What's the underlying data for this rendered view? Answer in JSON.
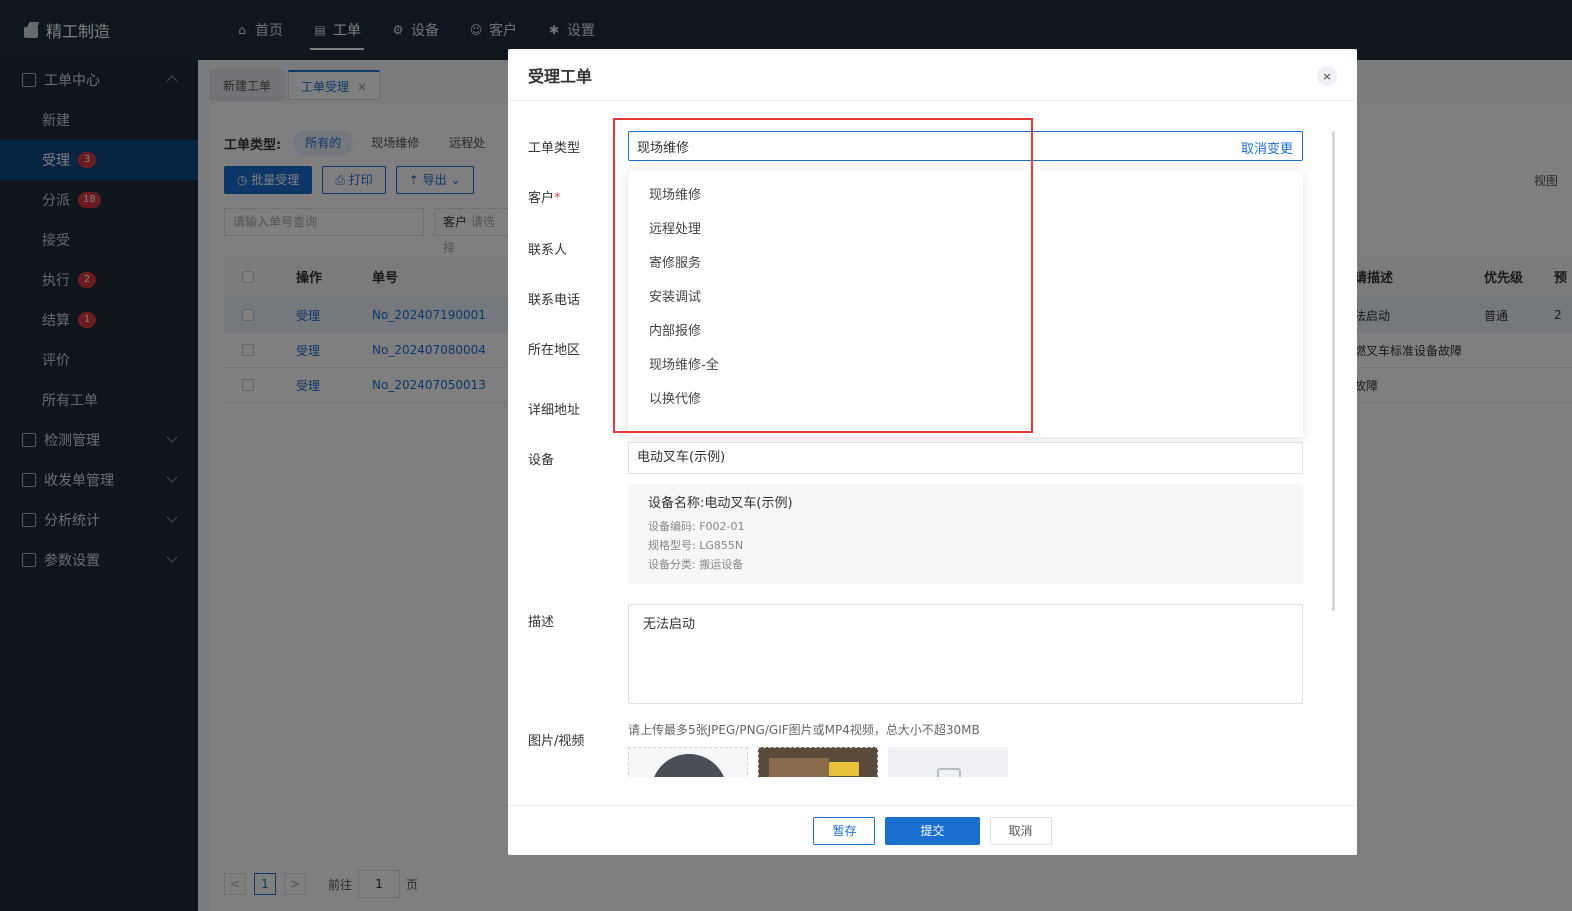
{
  "app": {
    "title": "精工制造"
  },
  "topnav": [
    {
      "label": "首页",
      "icon": "home-icon",
      "glyph": "⌂"
    },
    {
      "label": "工单",
      "icon": "workorder-icon",
      "glyph": "▤"
    },
    {
      "label": "设备",
      "icon": "device-icon",
      "glyph": "⚙"
    },
    {
      "label": "客户",
      "icon": "customer-icon",
      "glyph": "☺"
    },
    {
      "label": "设置",
      "icon": "settings-icon",
      "glyph": "✱"
    }
  ],
  "sidebar": {
    "group_workorder": "工单中心",
    "items": [
      {
        "label": "新建",
        "badge": ""
      },
      {
        "label": "受理",
        "badge": "3"
      },
      {
        "label": "分派",
        "badge": "18"
      },
      {
        "label": "接受",
        "badge": ""
      },
      {
        "label": "执行",
        "badge": "2"
      },
      {
        "label": "结算",
        "badge": "1"
      },
      {
        "label": "评价",
        "badge": ""
      },
      {
        "label": "所有工单",
        "badge": ""
      }
    ],
    "groups": [
      "检测管理",
      "收发单管理",
      "分析统计",
      "参数设置"
    ]
  },
  "tabs": [
    {
      "label": "新建工单"
    },
    {
      "label": "工单受理",
      "close": "×"
    }
  ],
  "list": {
    "filter_label": "工单类型:",
    "chips": [
      "所有的",
      "现场维修",
      "远程处"
    ],
    "buttons": [
      "批量受理",
      "打印",
      "导出"
    ],
    "search_placeholder": "请输入单号查询",
    "customer_label": "客户",
    "customer_placeholder": "请选择",
    "view_label": "视图",
    "columns": [
      "操作",
      "单号",
      "请描述",
      "优先级",
      "预"
    ],
    "rows": [
      {
        "action": "受理",
        "no": "No_202407190001",
        "desc": "法启动",
        "priority": "普通",
        "extra": "2"
      },
      {
        "action": "受理",
        "no": "No_202407080004",
        "desc": "燃叉车标准设备故障",
        "priority": "",
        "extra": ""
      },
      {
        "action": "受理",
        "no": "No_202407050013",
        "desc": "故障",
        "priority": "",
        "extra": ""
      }
    ],
    "pager": {
      "prev": "<",
      "current": "1",
      "next": ">",
      "goto_label": "前往",
      "goto_value": "1",
      "page_label": "页"
    }
  },
  "modal": {
    "title": "受理工单",
    "close": "×",
    "labels": {
      "type": "工单类型",
      "customer": "客户",
      "required_mark": "*",
      "contact": "联系人",
      "phone": "联系电话",
      "region": "所在地区",
      "address": "详细地址",
      "device": "设备",
      "desc": "描述",
      "media": "图片/视频"
    },
    "type_value": "现场维修",
    "cancel_change": "取消变更",
    "dropdown_options": [
      "现场维修",
      "远程处理",
      "寄修服务",
      "安装调试",
      "内部报修",
      "现场维修-全",
      "以换代修"
    ],
    "device_value": "电动叉车(示例)",
    "device_card": {
      "name": "设备名称:电动叉车(示例)",
      "code": "设备编码: F002-01",
      "model": "规格型号: LG855N",
      "category": "设备分类: 搬运设备"
    },
    "desc_value": "无法启动",
    "upload_hint": "请上传最多5张JPEG/PNG/GIF图片或MP4视频，总大小不超30MB",
    "footer": {
      "save": "暂存",
      "submit": "提交",
      "cancel": "取消"
    }
  },
  "colors": {
    "accent": "#1a6fd1",
    "highlight": "#e53935",
    "topbar": "#1f2d3d",
    "sidebar": "#1d2b3b"
  }
}
